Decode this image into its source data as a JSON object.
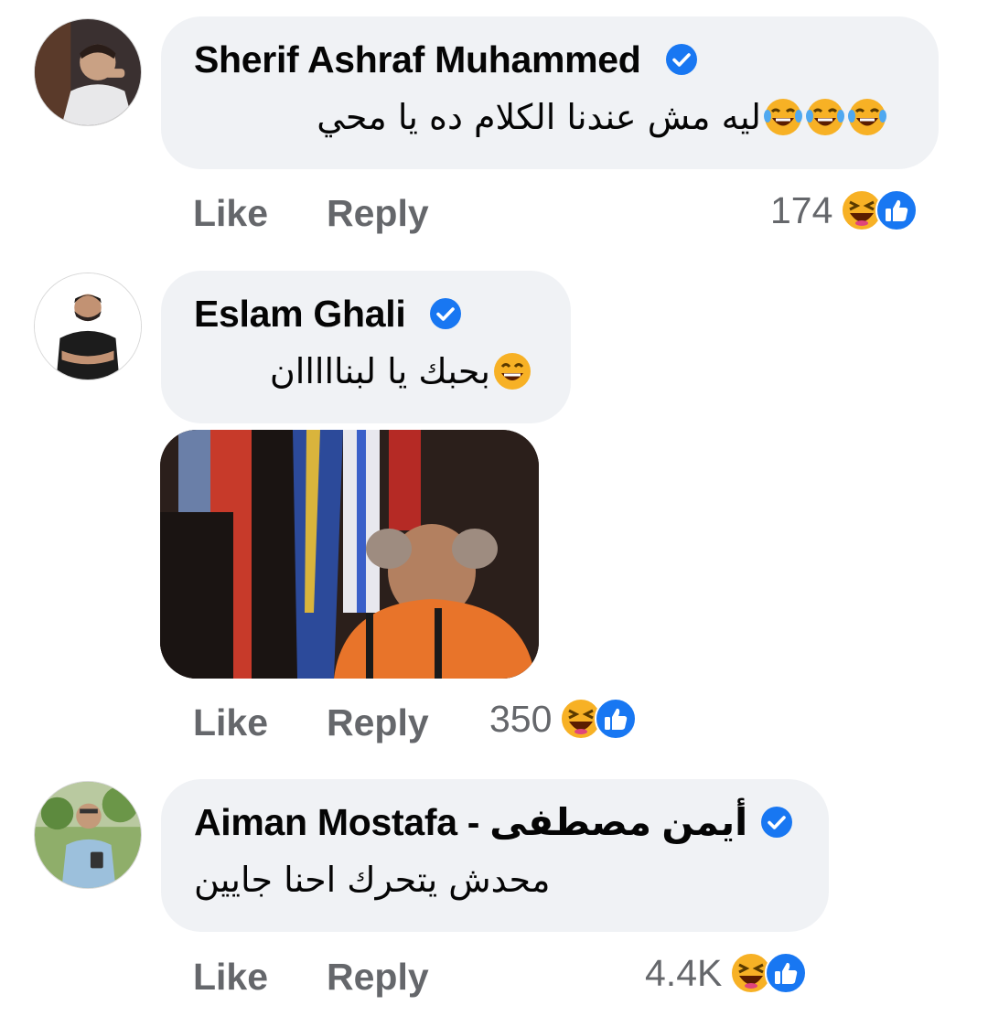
{
  "comments": [
    {
      "author": "Sherif Ashraf Muhammed",
      "verified": true,
      "text": "ليه مش عندنا الكلام ده يا محي",
      "text_emojis": [
        "tears-of-joy-emoji",
        "tears-of-joy-emoji",
        "tears-of-joy-emoji"
      ],
      "like_label": "Like",
      "reply_label": "Reply",
      "reaction_count": "174",
      "reaction_icons": [
        "haha-reaction-icon",
        "like-reaction-icon"
      ]
    },
    {
      "author": "Eslam Ghali",
      "verified": true,
      "text": "بحبك يا لبنااااان",
      "text_emojis": [
        "grinning-smiling-eyes-emoji"
      ],
      "has_gif": true,
      "like_label": "Like",
      "reply_label": "Reply",
      "reaction_count": "350",
      "reaction_icons": [
        "haha-reaction-icon",
        "like-reaction-icon"
      ]
    },
    {
      "author": "Aiman Mostafa - أيمن مصطفى",
      "verified": true,
      "text": "محدش يتحرك احنا جايين",
      "text_emojis": [],
      "like_label": "Like",
      "reply_label": "Reply",
      "reaction_count": "4.4K",
      "reaction_icons": [
        "haha-reaction-icon",
        "like-reaction-icon"
      ]
    }
  ],
  "colors": {
    "bubble": "#f0f2f5",
    "verified": "#1877f2",
    "meta_text": "#65676b",
    "haha": "#f7b125",
    "like": "#1877f2"
  }
}
